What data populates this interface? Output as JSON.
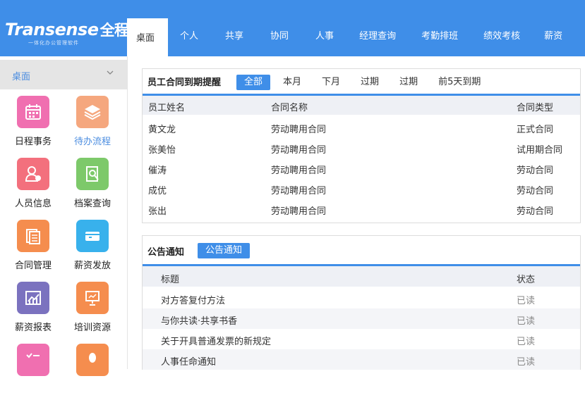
{
  "brand": {
    "name_en": "Transense",
    "name_cn": "全程",
    "tagline": "一体化办公管理软件"
  },
  "nav": {
    "items": [
      "桌面",
      "个人",
      "共享",
      "协同",
      "人事",
      "经理查询",
      "考勤排班",
      "绩效考核",
      "薪资"
    ],
    "active_index": 0
  },
  "sidebar": {
    "title": "桌面",
    "apps": [
      {
        "label": "日程事务",
        "icon": "calendar-icon",
        "color": "#f06fb0"
      },
      {
        "label": "待办流程",
        "icon": "layers-icon",
        "color": "#f5a77e",
        "highlight": true
      },
      {
        "label": "人员信息",
        "icon": "person-icon",
        "color": "#f3707d"
      },
      {
        "label": "档案查询",
        "icon": "document-search-icon",
        "color": "#7dc96a"
      },
      {
        "label": "合同管理",
        "icon": "contract-icon",
        "color": "#f58d4e"
      },
      {
        "label": "薪资发放",
        "icon": "card-icon",
        "color": "#38b1ec"
      },
      {
        "label": "薪资报表",
        "icon": "chart-icon",
        "color": "#7b72bf"
      },
      {
        "label": "培训资源",
        "icon": "presentation-icon",
        "color": "#f58d4e"
      },
      {
        "label": "",
        "icon": "checklist-icon",
        "color": "#f06fb0"
      },
      {
        "label": "",
        "icon": "user-icon",
        "color": "#f58d4e"
      }
    ]
  },
  "contracts": {
    "title": "员工合同到期提醒",
    "tabs": [
      "全部",
      "本月",
      "下月",
      "过期",
      "过期",
      "前5天到期"
    ],
    "active_tab": 0,
    "columns": [
      "员工姓名",
      "合同名称",
      "合同类型"
    ],
    "rows": [
      [
        "黄文龙",
        "劳动聘用合同",
        "正式合同"
      ],
      [
        "张美怡",
        "劳动聘用合同",
        "试用期合同"
      ],
      [
        "催涛",
        "劳动聘用合同",
        "劳动合同"
      ],
      [
        "成优",
        "劳动聘用合同",
        "劳动合同"
      ],
      [
        "张出",
        "劳动聘用合同",
        "劳动合同"
      ]
    ]
  },
  "notices": {
    "title": "公告通知",
    "tabs": [
      "公告通知"
    ],
    "columns": [
      "标题",
      "状态"
    ],
    "rows": [
      [
        "对方答复付方法",
        "已读"
      ],
      [
        "与你共读·共享书香",
        "已读"
      ],
      [
        "关于开具普通发票的新规定",
        "已读"
      ],
      [
        "人事任命通知",
        "已读"
      ]
    ]
  },
  "colors": {
    "accent": "#3f8ee8",
    "header_bg": "#eef0f5"
  }
}
